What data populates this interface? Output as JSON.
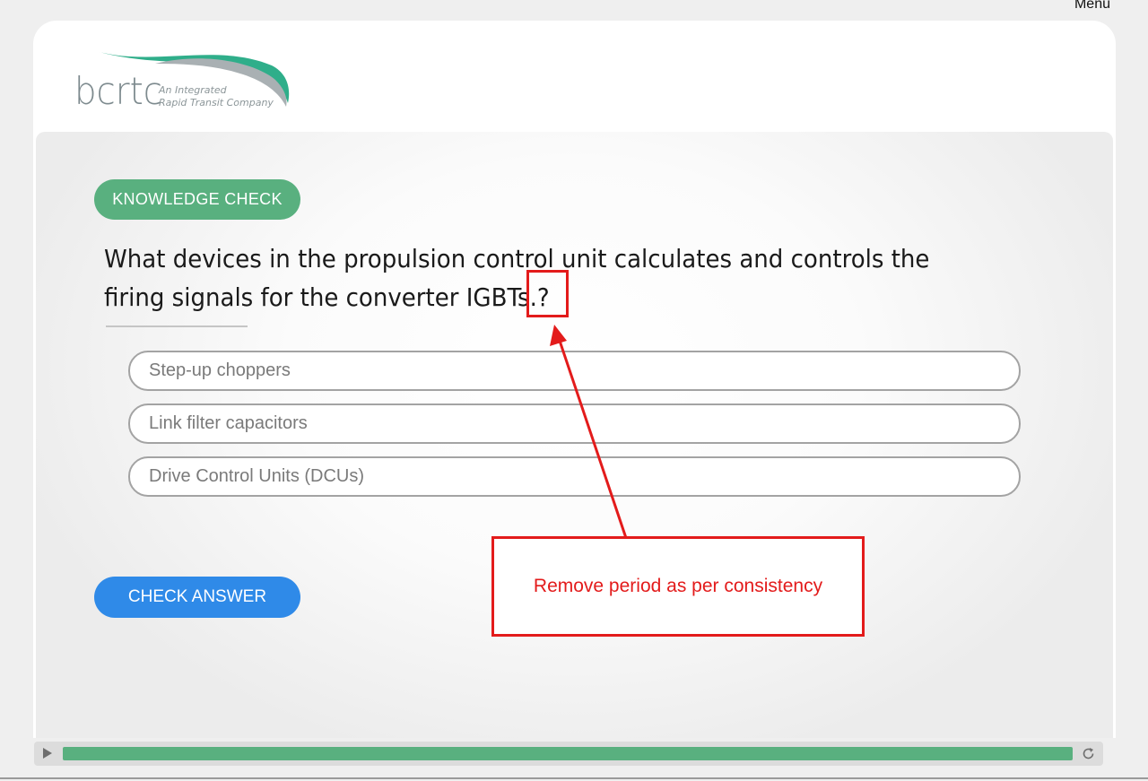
{
  "header": {
    "menu_label": "Menu"
  },
  "logo": {
    "wordmark": "bcrtc",
    "tagline": "An Integrated\nRapid Transit Company",
    "swoosh_colors": [
      "#2fae8a",
      "#a9b0b3"
    ]
  },
  "quiz": {
    "badge_label": "KNOWLEDGE CHECK",
    "question_before": "What devices in the propulsion control unit calculates and controls the firing signals for the converter IGBTs.?",
    "options": [
      {
        "label": "Step-up choppers"
      },
      {
        "label": "Link filter capacitors"
      },
      {
        "label": "Drive Control Units (DCUs)"
      }
    ],
    "check_answer_label": "CHECK ANSWER"
  },
  "annotation": {
    "comment": "Remove period as per consistency",
    "color": "#e31b1b"
  },
  "player": {
    "progress": 1.0,
    "play_icon": "play-icon",
    "replay_icon": "replay-icon",
    "progress_color": "#59b07f"
  },
  "colors": {
    "badge": "#59b07f",
    "check_button": "#2f8ae8"
  }
}
